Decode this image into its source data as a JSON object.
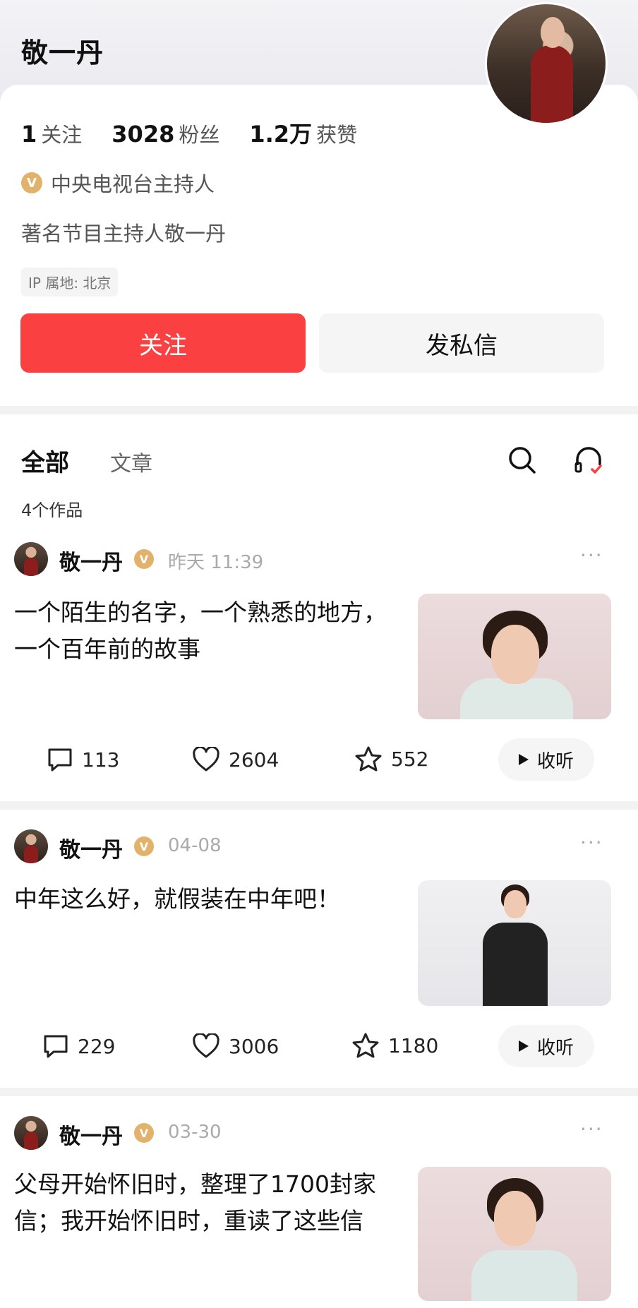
{
  "profile": {
    "name": "敬一丹",
    "stats": [
      {
        "value": "1",
        "label": "关注"
      },
      {
        "value": "3028",
        "label": "粉丝"
      },
      {
        "value": "1.2万",
        "label": "获赞"
      }
    ],
    "verify_badge": "V",
    "verify_text": "中央电视台主持人",
    "bio": "著名节目主持人敬一丹",
    "ip_location": "IP 属地: 北京",
    "follow_label": "关注",
    "message_label": "发私信"
  },
  "tabs": {
    "all": "全部",
    "article": "文章",
    "works_count": "4个作品"
  },
  "icons": [
    "search-icon",
    "headphones-icon",
    "comment-icon",
    "heart-icon",
    "star-icon",
    "play-icon",
    "more-icon",
    "verified-icon"
  ],
  "colors": {
    "accent": "#fa4040",
    "verified": "#e2b26a"
  },
  "posts": [
    {
      "author": "敬一丹",
      "time": "昨天  11:39",
      "text": "一个陌生的名字，一个熟悉的地方，一个百年前的故事",
      "comments": "113",
      "likes": "2604",
      "favorites": "552",
      "listen": "收听"
    },
    {
      "author": "敬一丹",
      "time": "04-08",
      "text": "中年这么好，就假装在中年吧！",
      "comments": "229",
      "likes": "3006",
      "favorites": "1180",
      "listen": "收听"
    },
    {
      "author": "敬一丹",
      "time": "03-30",
      "text": "父母开始怀旧时，整理了1700封家信；我开始怀旧时，重读了这些信",
      "comments": "",
      "likes": "",
      "favorites": "",
      "listen": ""
    }
  ],
  "more_glyph": "···"
}
